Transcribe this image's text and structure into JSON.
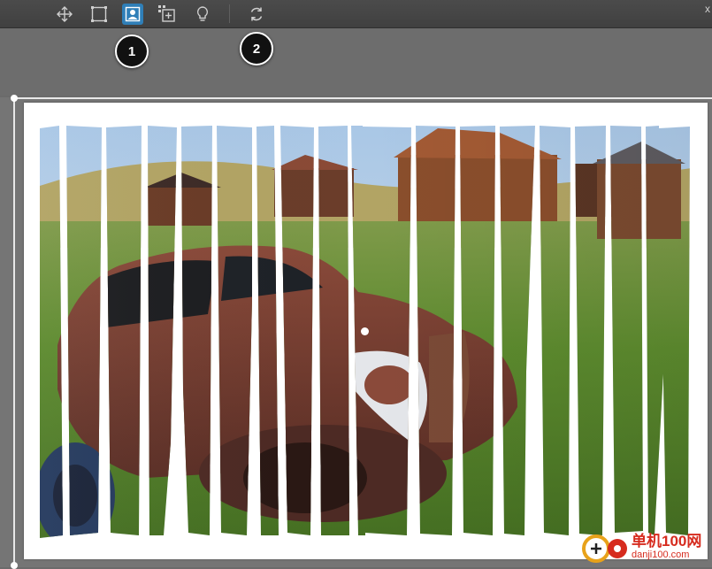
{
  "toolbar": {
    "tools": [
      {
        "name": "move-tool",
        "icon": "move-arrows-icon"
      },
      {
        "name": "crop-frame-tool",
        "icon": "dashed-rectangle-icon"
      },
      {
        "name": "portrait-tool",
        "icon": "person-frame-icon",
        "active": true
      },
      {
        "name": "add-frame-tool",
        "icon": "add-dashed-box-icon"
      },
      {
        "name": "hint-tool",
        "icon": "lightbulb-icon"
      },
      {
        "name": "rotate-tool",
        "icon": "refresh-arrows-icon"
      }
    ],
    "close_glyph": "x",
    "accent_color": "#2f7fb8"
  },
  "callouts": {
    "badge1": "1",
    "badge2": "2"
  },
  "canvas": {
    "paper_color": "#ffffff",
    "photo_description_icon": "folded-strips-photo-effect"
  },
  "watermark": {
    "main": "单机100网",
    "url": "danji100.com"
  }
}
